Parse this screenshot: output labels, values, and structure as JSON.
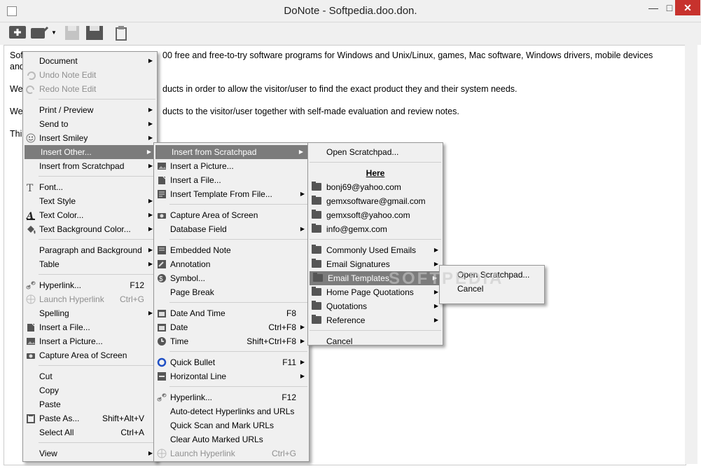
{
  "window": {
    "title": "DoNote - Softpedia.doo.don."
  },
  "editor": {
    "lines": [
      "Sof",
      "and",
      "We",
      "We",
      "Thi"
    ],
    "line1_right": "00 free and free-to-try software programs for Windows and Unix/Linux, games, Mac software, Windows drivers, mobile devices",
    "line3_right": "ducts in order to allow the visitor/user to find the exact product they and their system needs.",
    "line4_right": "ducts to the visitor/user together with self-made evaluation and review notes."
  },
  "menu1": [
    {
      "label": "Document",
      "arrow": true
    },
    {
      "label": "Undo Note Edit",
      "disabled": true,
      "icon": "undo-icon"
    },
    {
      "label": "Redo Note Edit",
      "disabled": true,
      "icon": "redo-icon"
    },
    {
      "label": "Print / Preview",
      "arrow": true
    },
    {
      "label": "Send to",
      "arrow": true
    },
    {
      "label": "Insert Smiley",
      "arrow": true,
      "icon": "smiley-icon"
    },
    {
      "label": "Insert Other...",
      "arrow": true,
      "highlight": true
    },
    {
      "label": "Insert from Scratchpad",
      "arrow": true
    },
    {
      "label": "Font...",
      "icon": "font-icon"
    },
    {
      "label": "Text Style",
      "arrow": true
    },
    {
      "label": "Text Color...",
      "arrow": true,
      "icon": "text-color-icon"
    },
    {
      "label": "Text Background Color...",
      "arrow": true,
      "icon": "bucket-icon"
    },
    {
      "label": "Paragraph and Background",
      "arrow": true
    },
    {
      "label": "Table",
      "arrow": true
    },
    {
      "label": "Hyperlink...",
      "shortcut": "F12",
      "icon": "link-icon"
    },
    {
      "label": "Launch Hyperlink",
      "shortcut": "Ctrl+G",
      "disabled": true,
      "icon": "globe-icon"
    },
    {
      "label": "Spelling",
      "arrow": true
    },
    {
      "label": "Insert a File...",
      "icon": "file-icon"
    },
    {
      "label": "Insert a Picture...",
      "icon": "picture-icon"
    },
    {
      "label": "Capture Area of Screen",
      "icon": "camera-icon"
    },
    {
      "label": "Cut"
    },
    {
      "label": "Copy"
    },
    {
      "label": "Paste"
    },
    {
      "label": "Paste As...",
      "shortcut": "Shift+Alt+V",
      "icon": "clipboard-icon"
    },
    {
      "label": "Select All",
      "shortcut": "Ctrl+A"
    },
    {
      "label": "View",
      "arrow": true
    }
  ],
  "menu2": [
    {
      "label": "Insert from Scratchpad",
      "arrow": true,
      "highlight": true
    },
    {
      "label": "Insert a Picture...",
      "icon": "picture-icon"
    },
    {
      "label": "Insert a File...",
      "icon": "file-icon"
    },
    {
      "label": "Insert Template From File...",
      "arrow": true,
      "icon": "template-icon"
    },
    {
      "label": "Capture Area of Screen",
      "icon": "camera-icon"
    },
    {
      "label": "Database Field",
      "arrow": true
    },
    {
      "label": "Embedded Note",
      "icon": "note-icon"
    },
    {
      "label": "Annotation",
      "icon": "annotation-icon"
    },
    {
      "label": "Symbol...",
      "icon": "symbol-icon"
    },
    {
      "label": "Page Break"
    },
    {
      "label": "Date And Time",
      "shortcut": "F8",
      "icon": "calendar-icon"
    },
    {
      "label": "Date",
      "shortcut": "Ctrl+F8",
      "arrow": true,
      "icon": "date-icon"
    },
    {
      "label": "Time",
      "shortcut": "Shift+Ctrl+F8",
      "arrow": true,
      "icon": "clock-icon"
    },
    {
      "label": "Quick Bullet",
      "shortcut": "F11",
      "arrow": true,
      "icon": "bullet-icon"
    },
    {
      "label": "Horizontal Line",
      "arrow": true,
      "icon": "hline-icon"
    },
    {
      "label": "Hyperlink...",
      "shortcut": "F12",
      "icon": "link-icon"
    },
    {
      "label": "Auto-detect Hyperlinks and URLs"
    },
    {
      "label": "Quick Scan and Mark URLs"
    },
    {
      "label": "Clear Auto Marked URLs"
    },
    {
      "label": "Launch Hyperlink",
      "shortcut": "Ctrl+G",
      "disabled": true,
      "icon": "globe-icon"
    }
  ],
  "menu3": [
    {
      "label": "Open Scratchpad..."
    },
    {
      "label": "Here",
      "header": true
    },
    {
      "label": "bonj69@yahoo.com",
      "folder": true
    },
    {
      "label": "gemxsoftware@gmail.com",
      "folder": true
    },
    {
      "label": "gemxsoft@yahoo.com",
      "folder": true
    },
    {
      "label": "info@gemx.com",
      "folder": true
    },
    {
      "label": "Commonly Used Emails",
      "folder": true,
      "arrow": true
    },
    {
      "label": "Email Signatures",
      "folder": true,
      "arrow": true
    },
    {
      "label": "Email Templates",
      "folder": true,
      "arrow": true,
      "highlight": true
    },
    {
      "label": "Home Page Quotations",
      "folder": true,
      "arrow": true
    },
    {
      "label": "Quotations",
      "folder": true,
      "arrow": true
    },
    {
      "label": "Reference",
      "folder": true,
      "arrow": true
    },
    {
      "label": "Cancel"
    }
  ],
  "menu4": [
    {
      "label": "Open Scratchpad..."
    },
    {
      "label": "Cancel"
    }
  ],
  "watermark": "SOFTPEDIA"
}
